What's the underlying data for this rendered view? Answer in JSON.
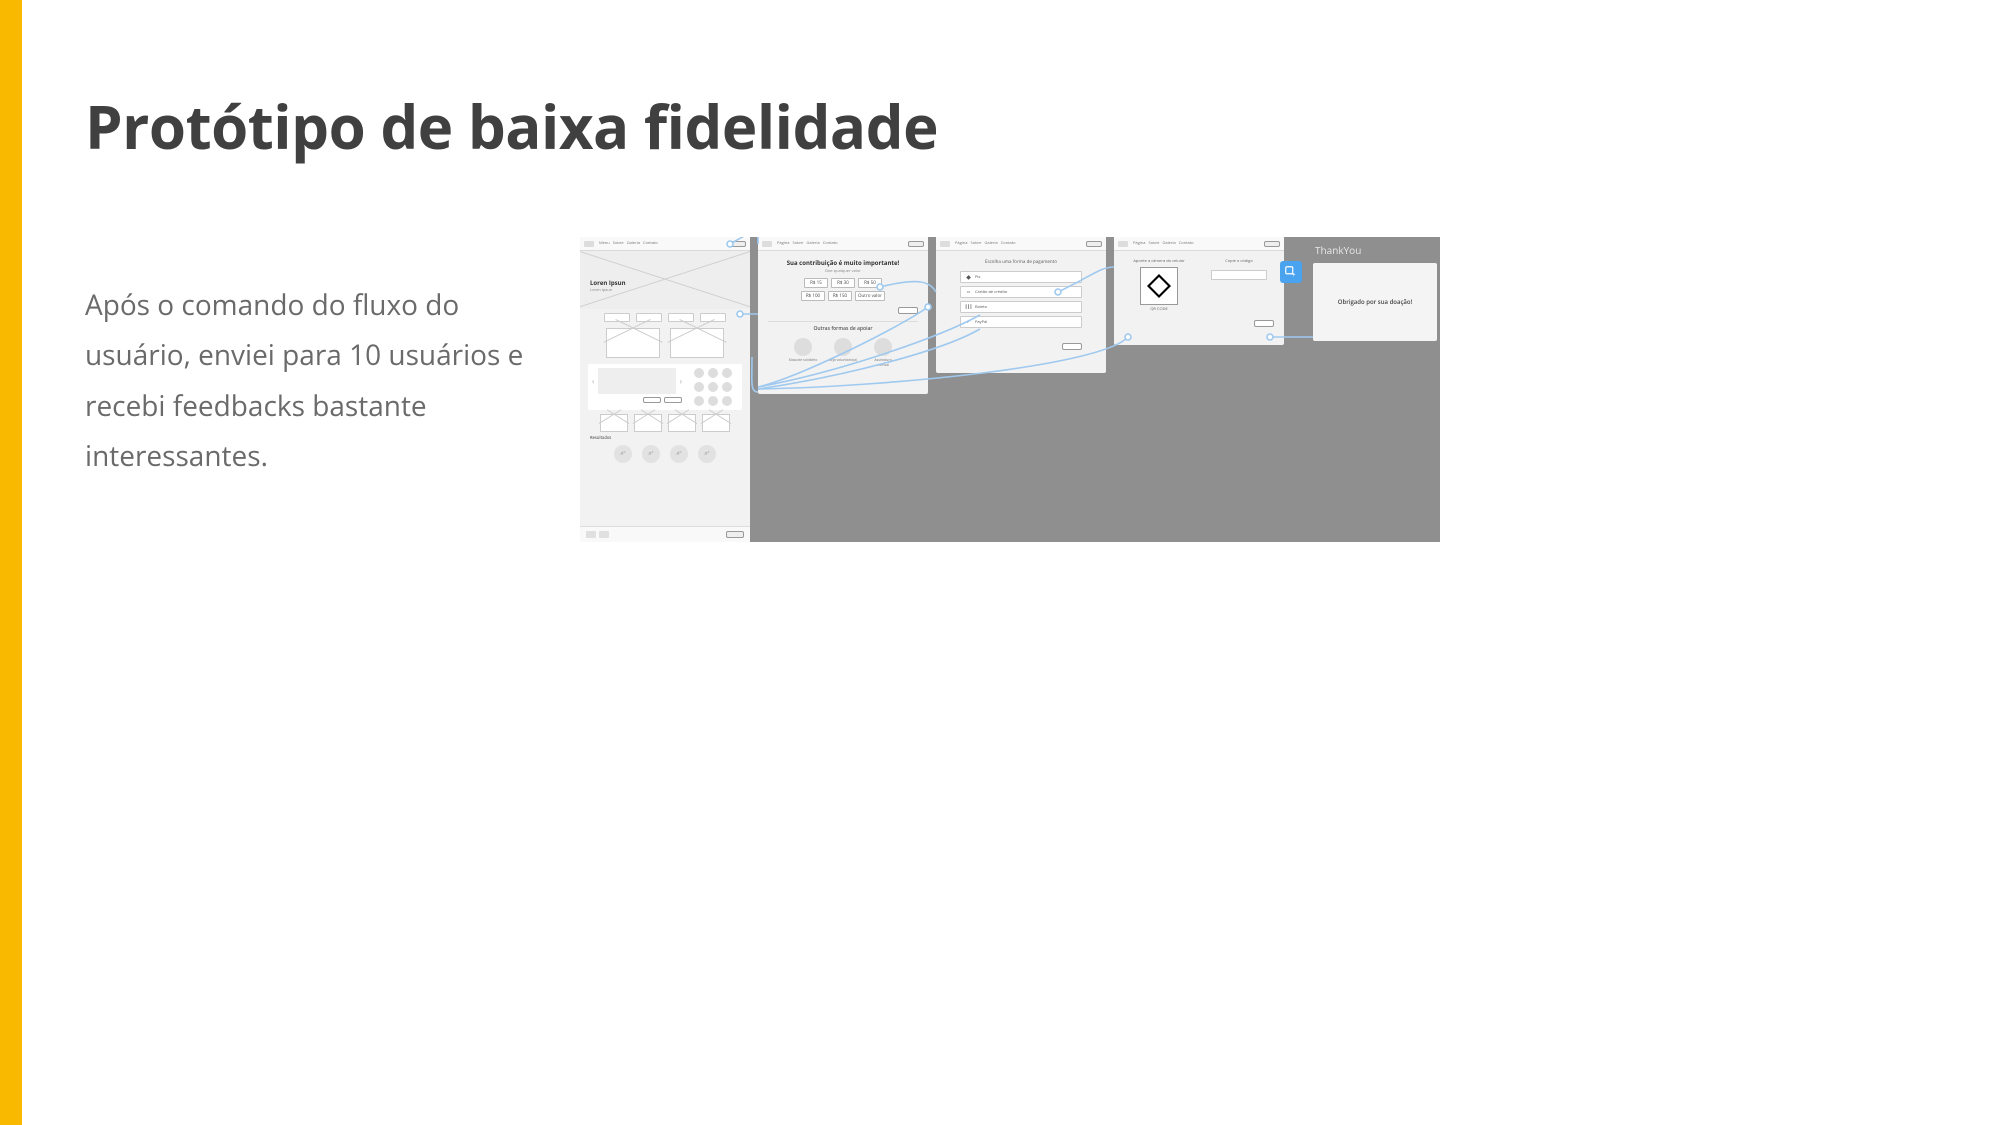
{
  "title": "Protótipo de baixa fidelidade",
  "body": "Após o comando do fluxo do usuário, enviei para 10 usuários e recebi feedbacks bastante interessantes.",
  "wireframe": {
    "frame1": {
      "heroTitle": "Loren Ipsun",
      "heroSub": "Loren Ipsun"
    },
    "frame2": {
      "heading": "Sua contribuição é muito importante!",
      "sub": "Doe qualquer valor",
      "amounts": [
        "R$ 15",
        "R$ 30",
        "R$ 50",
        "R$ 100",
        "R$ 150"
      ],
      "otherLabel": "Outro valor",
      "altHeading": "Outras formas de apoiar",
      "opts": [
        "Mascote solidário",
        "Seja voluntário(a)",
        "Assinatura mensal"
      ]
    },
    "frame3": {
      "heading": "Escolha uma forma de pagamento",
      "opts": [
        "Pix",
        "Cartão de crédito",
        "Boleto",
        "PayPal"
      ]
    },
    "frame4": {
      "left": "Aponte a câmera do celular",
      "qrCaption": "QR CODE",
      "right": "Copie o código"
    },
    "thankyou": {
      "label": "ThankYou",
      "text": "Obrigado por sua doação!"
    }
  }
}
